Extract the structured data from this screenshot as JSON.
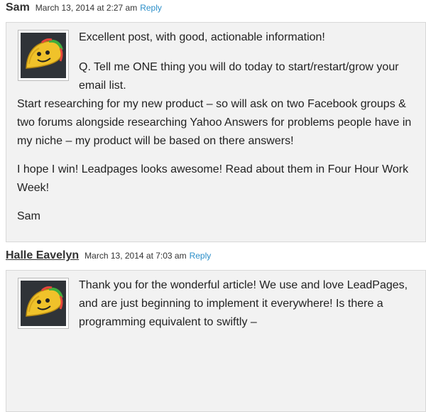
{
  "comments": [
    {
      "author": "Sam",
      "date": "March 13, 2014 at 2:27 am",
      "reply": "Reply",
      "paragraphs": [
        "Excellent post, with good, actionable information!",
        "Q. Tell me ONE thing you will do today to start/restart/grow your email list.\nStart researching for my new product – so will ask on two Facebook groups & two forums alongside researching Yahoo Answers for problems people have in my niche – my product will be based on there answers!",
        "I hope I win! Leadpages looks awesome! Read about them in Four Hour Work Week!",
        "Sam"
      ]
    },
    {
      "author": "Halle Eavelyn",
      "date": "March 13, 2014 at 7:03 am",
      "reply": "Reply",
      "paragraphs": [
        "Thank you for the wonderful article! We use and love LeadPages, and are just beginning to implement it everywhere! Is there a programming equivalent to swiftly –"
      ]
    }
  ],
  "avatar_icon": "taco-avatar-icon",
  "colors": {
    "link": "#2a8ec9",
    "box_bg": "#f2f2f2",
    "avatar_bg": "#2f3338"
  }
}
